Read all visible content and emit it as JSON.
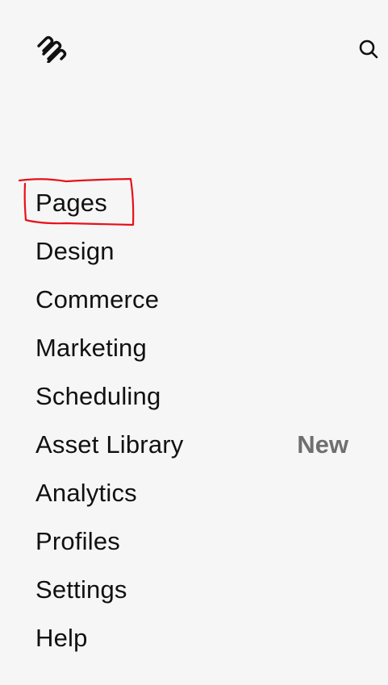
{
  "header": {
    "logo_icon": "squarespace-logo-icon",
    "search_icon": "search-icon"
  },
  "nav": {
    "items": [
      {
        "label": "Pages"
      },
      {
        "label": "Design"
      },
      {
        "label": "Commerce"
      },
      {
        "label": "Marketing"
      },
      {
        "label": "Scheduling"
      },
      {
        "label": "Asset Library",
        "badge": "New"
      },
      {
        "label": "Analytics"
      },
      {
        "label": "Profiles"
      },
      {
        "label": "Settings"
      },
      {
        "label": "Help"
      }
    ]
  },
  "annotation": {
    "color": "#e8101a",
    "target": "Pages"
  }
}
